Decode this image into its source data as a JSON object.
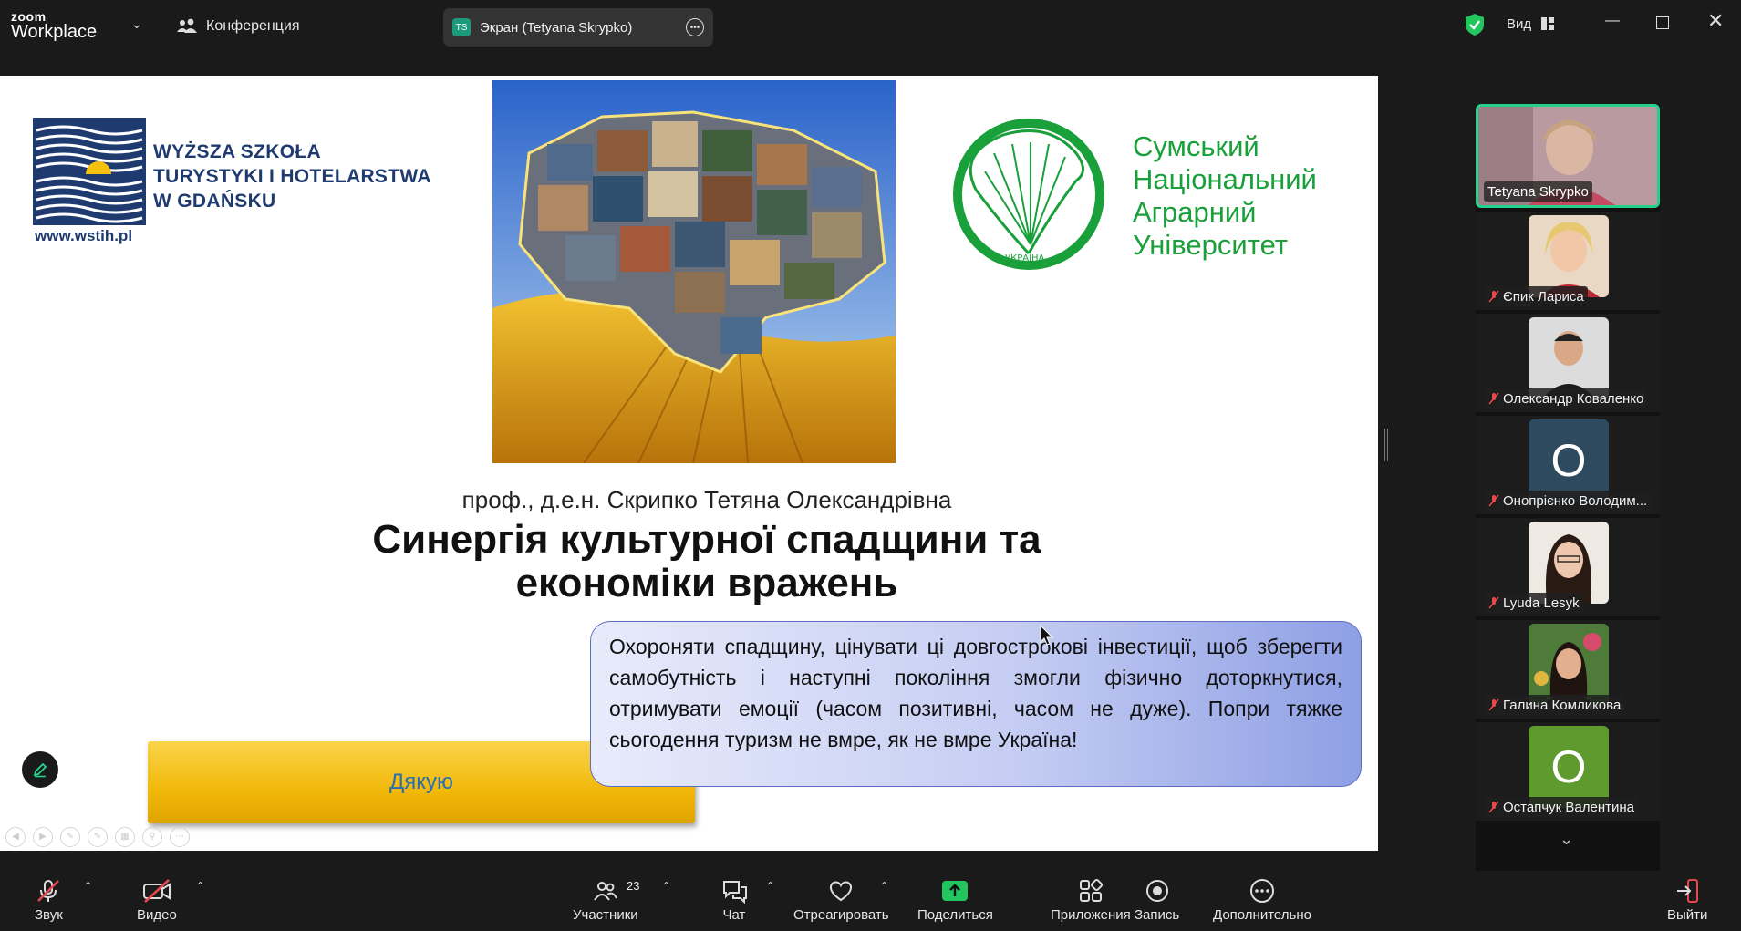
{
  "app": {
    "brand_line1": "zoom",
    "brand_line2": "Workplace",
    "conference_label": "Конференция",
    "screen_tab": {
      "initials": "TS",
      "label": "Экран (Tetyana Skrypko)"
    },
    "view_label": "Вид"
  },
  "slide": {
    "wstih": {
      "name_lines": [
        "WYŻSZA SZKOŁA",
        "TURYSTYKI I HOTELARSTWA",
        "W GDAŃSKU"
      ],
      "url": "www.wstih.pl"
    },
    "snau": {
      "name_lines": [
        "Сумський",
        "Національний",
        "Аграрний",
        "Університет"
      ],
      "emblem_text": "УКРАЇНА"
    },
    "author": "проф., д.е.н. Скрипко Тетяна Олександрівна",
    "title_line1": "Синергія культурної спадщини та",
    "title_line2": "економіки вражень",
    "quote": "Охороняти спадщину, цінувати ці довгострокові інвестиції, щоб зберегти самобутність і наступні покоління змогли фізично доторкнутися, отримувати емоції (часом позитивні, часом не дуже). Попри тяжке сьогодення туризм не вмре, як не вмре Україна!",
    "thanks_label": "Дякую"
  },
  "participants_gallery": [
    {
      "name": "Tetyana Skrypko",
      "active": true,
      "muted": false
    },
    {
      "name": "Єпик Лариса",
      "muted": true
    },
    {
      "name": "Олександр Коваленко",
      "muted": true
    },
    {
      "name": "Онопрієнко Володим...",
      "muted": true,
      "letter": "О"
    },
    {
      "name": "Lyuda Lesyk",
      "muted": true
    },
    {
      "name": "Галина Комликова",
      "muted": true
    },
    {
      "name": "Остапчук Валентина",
      "muted": true,
      "letter": "О"
    }
  ],
  "toolbar": {
    "audio": "Звук",
    "video": "Видео",
    "participants": "Участники",
    "participants_count": "23",
    "chat": "Чат",
    "react": "Отреагировать",
    "share": "Поделиться",
    "apps": "Приложения",
    "record": "Запись",
    "more": "Дополнительно",
    "leave": "Выйти"
  },
  "colors": {
    "accent_green": "#23d18b",
    "share_green": "#22c55e",
    "leave_red": "#e5484d",
    "snau_green": "#1aa03a",
    "wstih_blue": "#1e3a6e"
  }
}
